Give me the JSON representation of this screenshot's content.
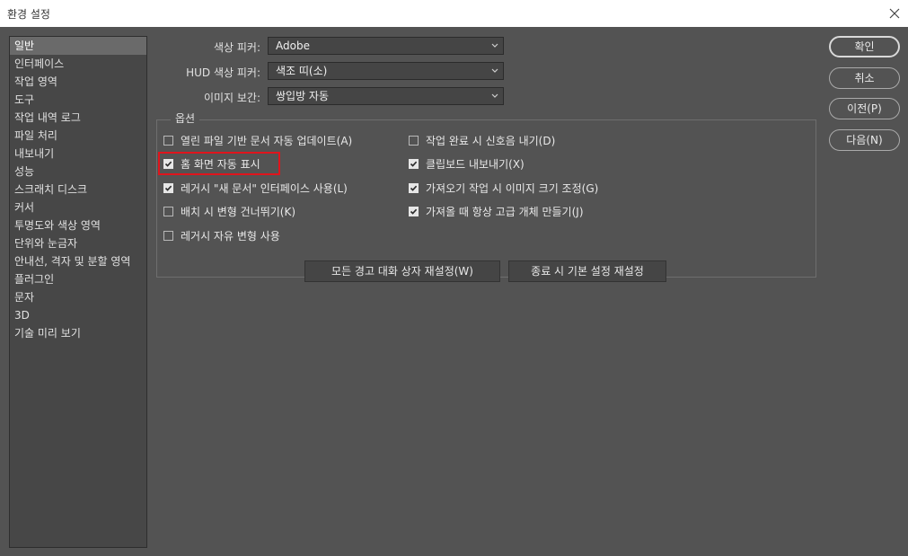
{
  "window": {
    "title": "환경 설정",
    "close_icon": "close-icon"
  },
  "sidebar": {
    "items": [
      {
        "label": "일반",
        "selected": true
      },
      {
        "label": "인터페이스"
      },
      {
        "label": "작업 영역"
      },
      {
        "label": "도구"
      },
      {
        "label": "작업 내역 로그"
      },
      {
        "label": "파일 처리"
      },
      {
        "label": "내보내기"
      },
      {
        "label": "성능"
      },
      {
        "label": "스크래치 디스크"
      },
      {
        "label": "커서"
      },
      {
        "label": "투명도와 색상 영역"
      },
      {
        "label": "단위와 눈금자"
      },
      {
        "label": "안내선, 격자 및 분할 영역"
      },
      {
        "label": "플러그인"
      },
      {
        "label": "문자"
      },
      {
        "label": "3D"
      },
      {
        "label": "기술 미리 보기"
      }
    ]
  },
  "fields": {
    "color_picker": {
      "label": "색상 피커:",
      "value": "Adobe"
    },
    "hud_color_picker": {
      "label": "HUD 색상 피커:",
      "value": "색조 띠(소)"
    },
    "image_interpolation": {
      "label": "이미지 보간:",
      "value": "쌍입방 자동"
    }
  },
  "options": {
    "legend": "옵션",
    "left": [
      {
        "label": "열린 파일 기반 문서 자동 업데이트(A)",
        "checked": false
      },
      {
        "label": "홈 화면 자동 표시",
        "checked": true
      },
      {
        "label": "레거시 \"새 문서\" 인터페이스 사용(L)",
        "checked": true
      },
      {
        "label": "배치 시 변형 건너뛰기(K)",
        "checked": false
      },
      {
        "label": "레거시 자유 변형 사용",
        "checked": false
      }
    ],
    "right": [
      {
        "label": "작업 완료 시 신호음 내기(D)",
        "checked": false
      },
      {
        "label": "클립보드 내보내기(X)",
        "checked": true
      },
      {
        "label": "가져오기 작업 시 이미지 크기 조정(G)",
        "checked": true
      },
      {
        "label": "가져올 때 항상 고급 개체 만들기(J)",
        "checked": true
      }
    ]
  },
  "buttons": {
    "reset_warnings": "모든 경고 대화 상자 재설정(W)",
    "reset_on_quit": "종료 시 기본 설정 재설정",
    "ok": "확인",
    "cancel": "취소",
    "prev": "이전(P)",
    "next": "다음(N)"
  },
  "colors": {
    "dialog_bg": "#535353",
    "sidebar_bg": "#474747",
    "selected_bg": "#6a6a6a",
    "highlight": "#e0141c"
  }
}
